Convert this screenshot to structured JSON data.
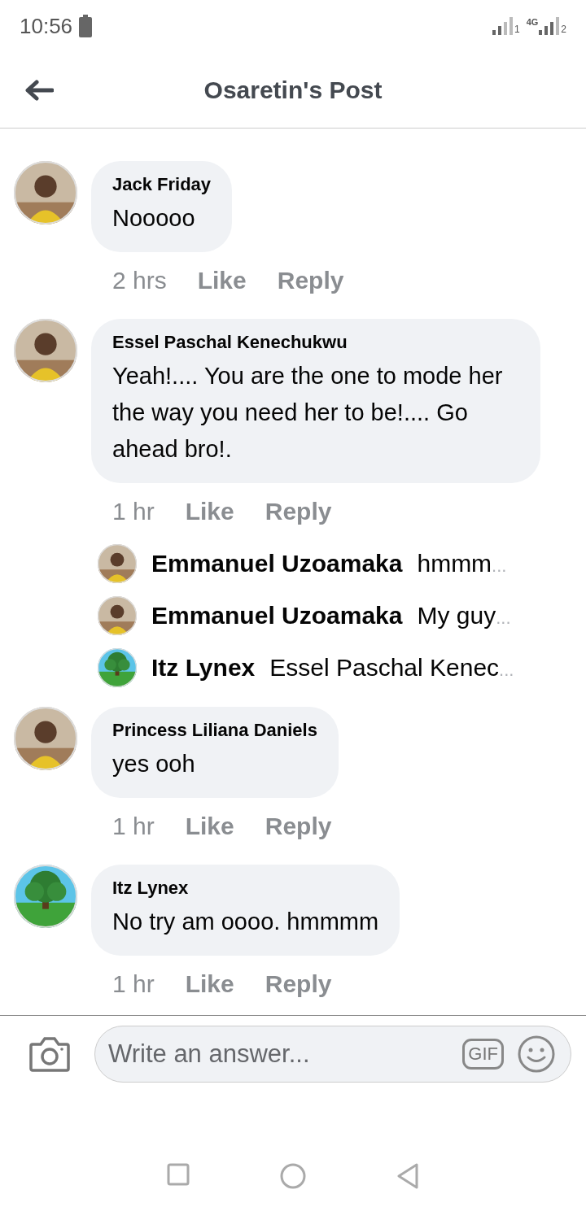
{
  "status_bar": {
    "time": "10:56",
    "network": "4G",
    "sim_1": "1",
    "sim_2": "2"
  },
  "header": {
    "title": "Osaretin's Post"
  },
  "comments": [
    {
      "author": "Jack Friday",
      "text": "Nooooo",
      "time": "2 hrs",
      "like": "Like",
      "reply": "Reply"
    },
    {
      "author": "Essel Paschal Kenechukwu",
      "text": "Yeah!.... You are the one to mode her the way you need her to be!.... Go ahead bro!.",
      "time": "1 hr",
      "like": "Like",
      "reply": "Reply",
      "replies": [
        {
          "author": "Emmanuel Uzoamaka",
          "text": "hmmm",
          "more": "..."
        },
        {
          "author": "Emmanuel Uzoamaka",
          "text": "My guy",
          "more": "..."
        },
        {
          "author": "Itz Lynex",
          "text": "Essel Paschal Kenec",
          "more": "..."
        }
      ]
    },
    {
      "author": "Princess Liliana Daniels",
      "text": "yes ooh",
      "time": "1 hr",
      "like": "Like",
      "reply": "Reply"
    },
    {
      "author": "Itz Lynex",
      "text": "No try am oooo. hmmmm",
      "time": "1 hr",
      "like": "Like",
      "reply": "Reply"
    }
  ],
  "composer": {
    "placeholder": "Write an answer...",
    "gif": "GIF"
  }
}
